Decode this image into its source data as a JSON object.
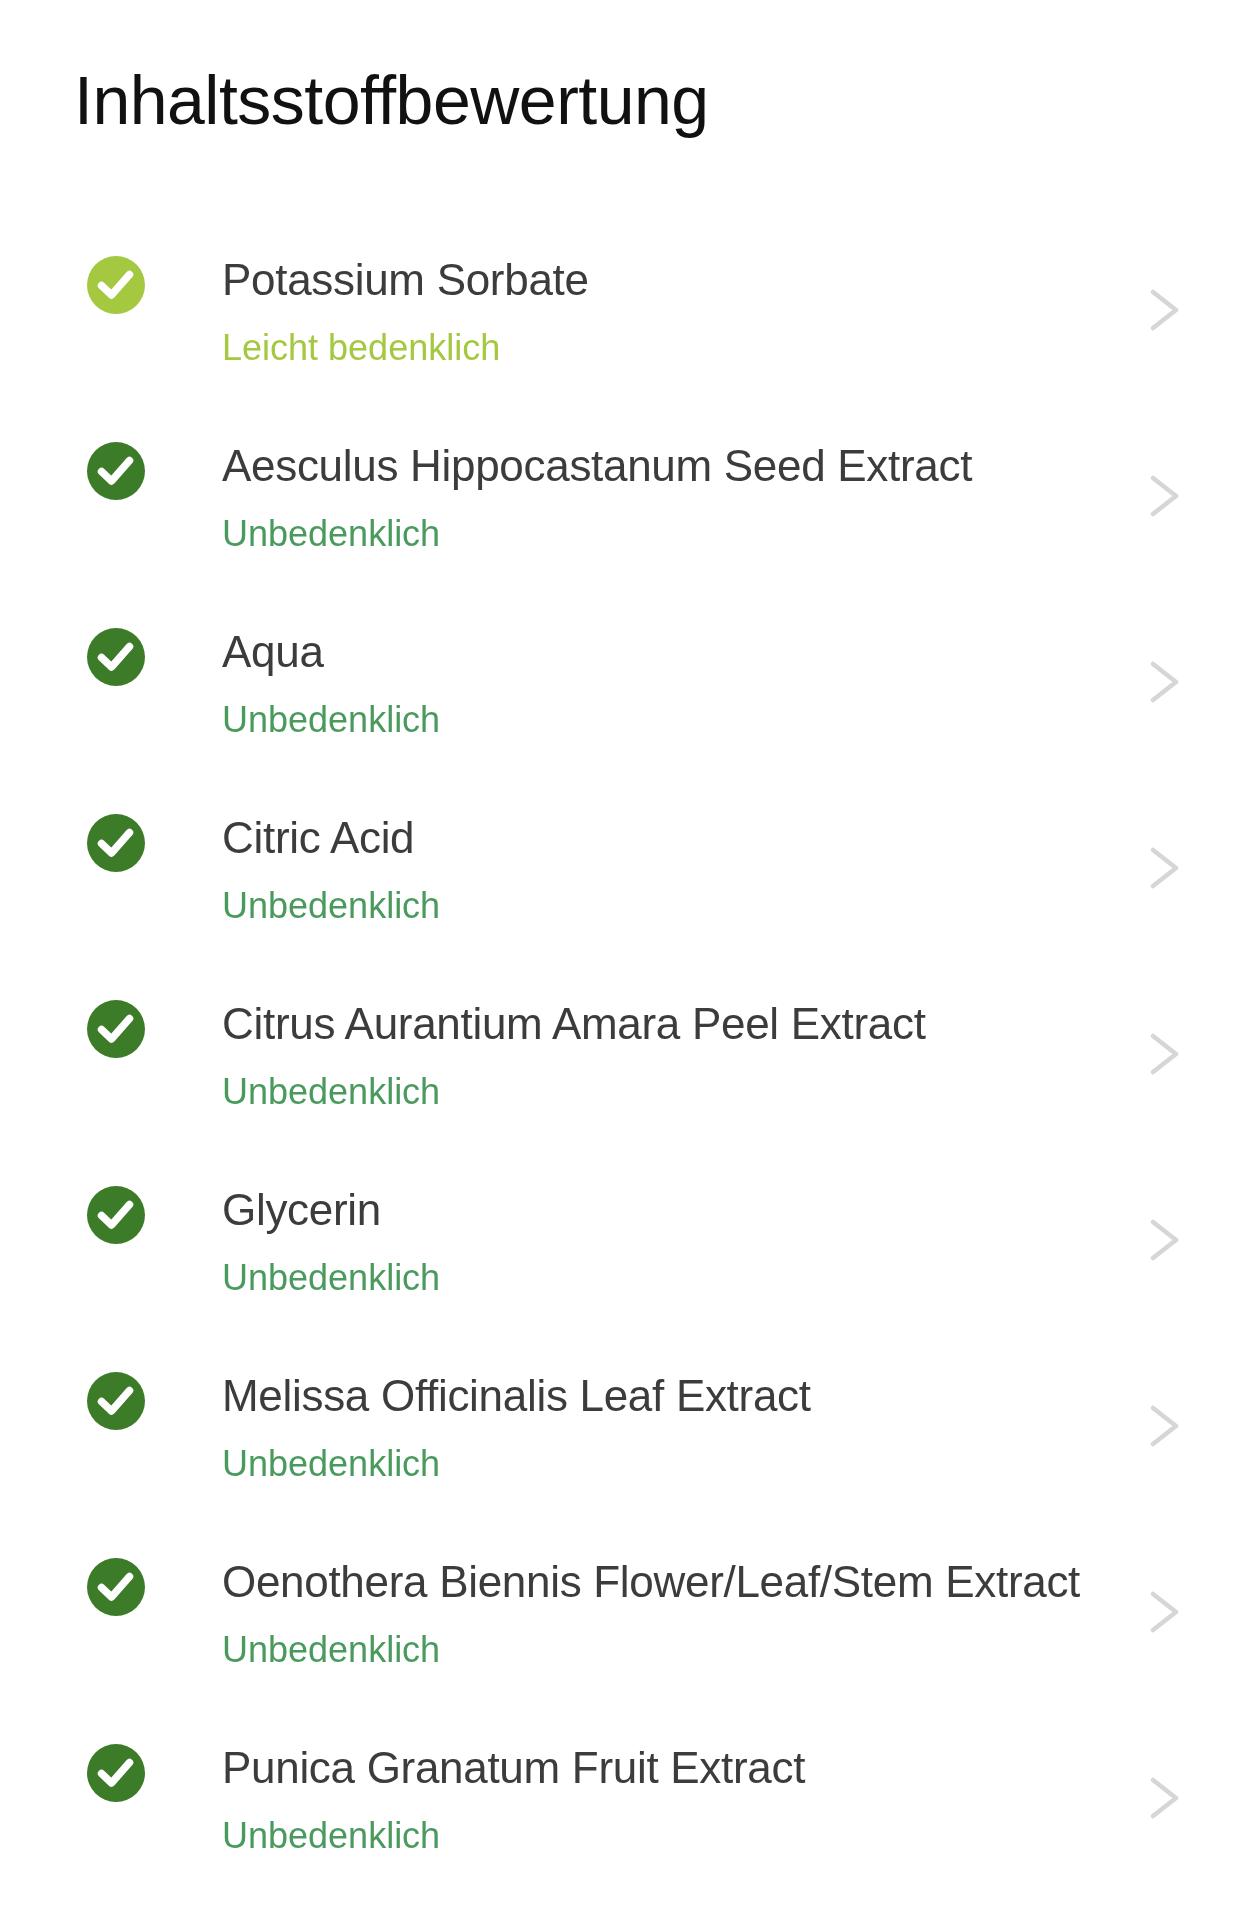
{
  "title": "Inhaltsstoffbewertung",
  "ingredients": [
    {
      "name": "Potassium Sorbate",
      "rating": "Leicht bedenklich",
      "kind": "mild",
      "color": "#a4c83f"
    },
    {
      "name": "Aesculus Hippocastanum Seed Extract",
      "rating": "Unbedenklich",
      "kind": "safe",
      "color": "#3c7b27"
    },
    {
      "name": "Aqua",
      "rating": "Unbedenklich",
      "kind": "safe",
      "color": "#3c7b27"
    },
    {
      "name": "Citric Acid",
      "rating": "Unbedenklich",
      "kind": "safe",
      "color": "#3c7b27"
    },
    {
      "name": "Citrus Aurantium Amara Peel Extract",
      "rating": "Unbedenklich",
      "kind": "safe",
      "color": "#3c7b27"
    },
    {
      "name": "Glycerin",
      "rating": "Unbedenklich",
      "kind": "safe",
      "color": "#3c7b27"
    },
    {
      "name": "Melissa Officinalis Leaf Extract",
      "rating": "Unbedenklich",
      "kind": "safe",
      "color": "#3c7b27"
    },
    {
      "name": "Oenothera Biennis Flower/Leaf/Stem Extract",
      "rating": "Unbedenklich",
      "kind": "safe",
      "color": "#3c7b27"
    },
    {
      "name": "Punica Granatum Fruit Extract",
      "rating": "Unbedenklich",
      "kind": "safe",
      "color": "#3c7b27"
    }
  ]
}
